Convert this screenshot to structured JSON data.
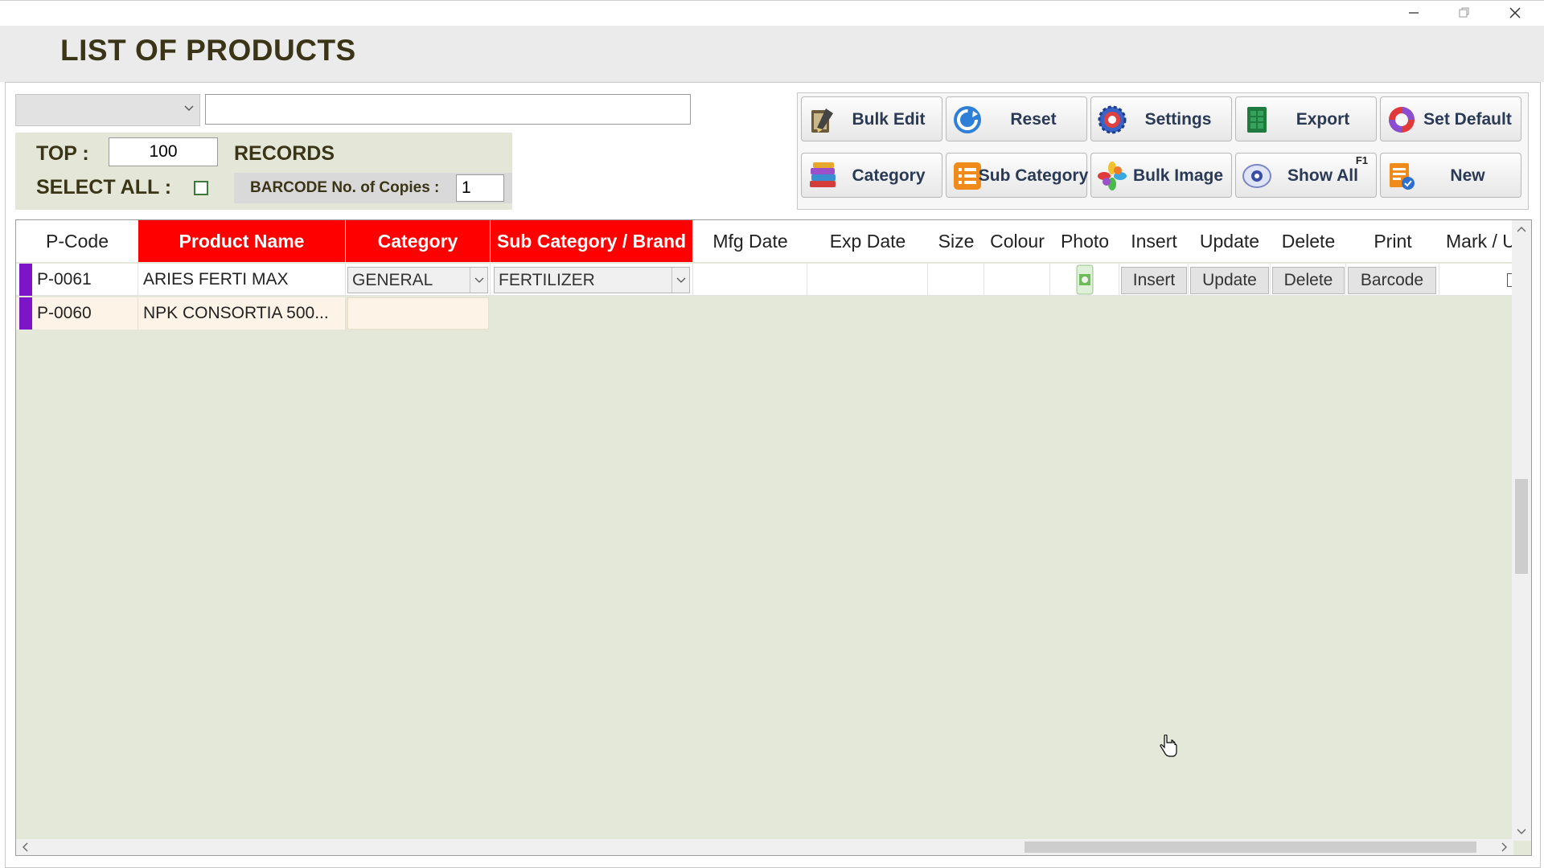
{
  "window": {
    "title": "LIST OF PRODUCTS"
  },
  "filter": {
    "dropdown_value": "",
    "search_value": ""
  },
  "options": {
    "top_label": "TOP :",
    "top_value": "100",
    "records_label": "RECORDS",
    "select_all_label": "SELECT ALL :",
    "barcode_label": "BARCODE No. of Copies :",
    "barcode_copies": "1"
  },
  "toolbar": {
    "bulk_edit": "Bulk Edit",
    "reset": "Reset",
    "settings": "Settings",
    "export": "Export",
    "set_default": "Set Default",
    "category": "Category",
    "sub_category": "Sub Category",
    "bulk_image": "Bulk Image",
    "show_all": "Show All",
    "show_all_shortcut": "F1",
    "new": "New"
  },
  "grid": {
    "columns": [
      "P-Code",
      "Product Name",
      "Category",
      "Sub Category / Brand",
      "Mfg Date",
      "Exp Date",
      "Size",
      "Colour",
      "Photo",
      "Insert",
      "Update",
      "Delete",
      "Print",
      "Mark / U"
    ],
    "rows": [
      {
        "p_code": "P-0061",
        "product_name": "ARIES FERTI MAX",
        "category": "GENERAL",
        "sub_category": "FERTILIZER",
        "insert_label": "Insert",
        "update_label": "Update",
        "delete_label": "Delete",
        "print_label": "Barcode"
      },
      {
        "p_code": "P-0060",
        "product_name": "NPK CONSORTIA 500...",
        "category": "",
        "sub_category": ""
      }
    ]
  },
  "colors": {
    "header_highlight": "#ff0000",
    "row_marker": "#7d14c8",
    "grid_bg": "#e4e8d9"
  }
}
